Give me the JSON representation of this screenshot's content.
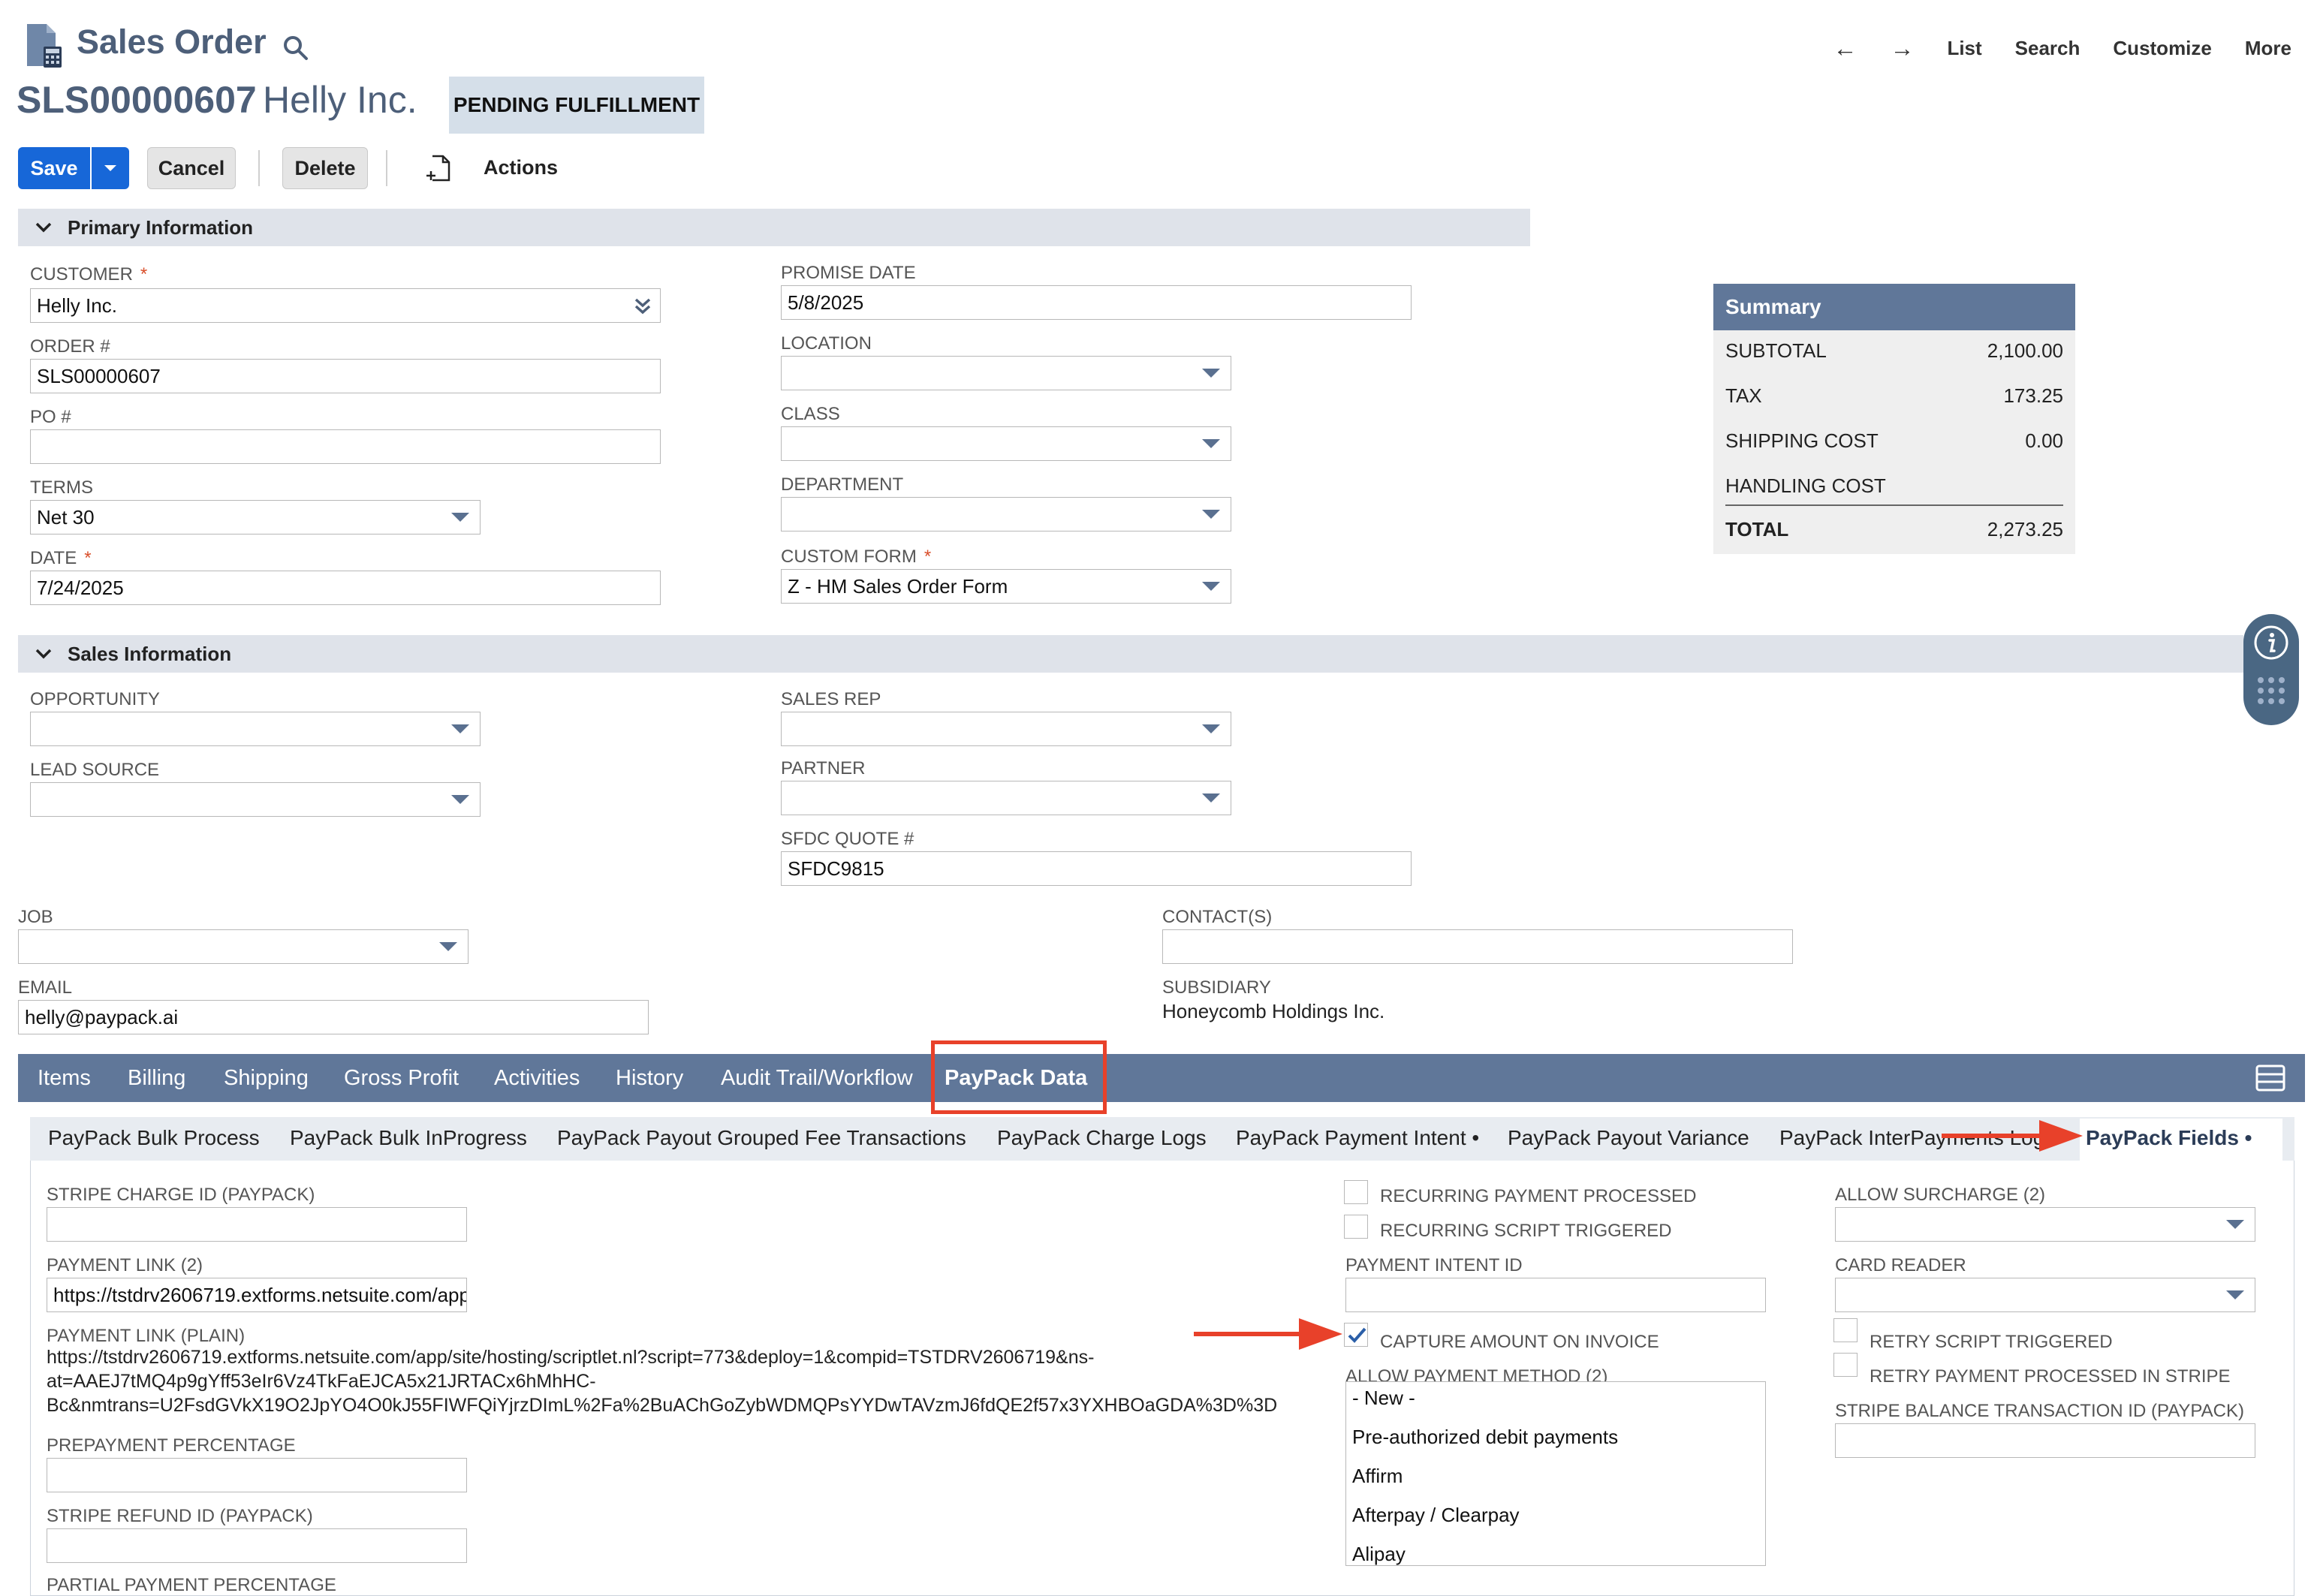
{
  "header": {
    "record_type": "Sales Order",
    "record_id": "SLS00000607",
    "record_name": "Helly Inc.",
    "status": "PENDING FULFILLMENT",
    "nav": {
      "back": "←",
      "forward": "→",
      "list": "List",
      "search": "Search",
      "customize": "Customize",
      "more": "More"
    }
  },
  "toolbar": {
    "save": "Save",
    "cancel": "Cancel",
    "delete": "Delete",
    "actions": "Actions"
  },
  "primary": {
    "title": "Primary Information",
    "customer": {
      "label": "CUSTOMER",
      "value": "Helly Inc."
    },
    "order_no": {
      "label": "ORDER #",
      "value": "SLS00000607"
    },
    "po_no": {
      "label": "PO #",
      "value": ""
    },
    "terms": {
      "label": "TERMS",
      "value": "Net 30"
    },
    "date": {
      "label": "DATE",
      "value": "7/24/2025"
    },
    "promise_date": {
      "label": "PROMISE DATE",
      "value": "5/8/2025"
    },
    "location": {
      "label": "LOCATION",
      "value": ""
    },
    "class": {
      "label": "CLASS",
      "value": ""
    },
    "department": {
      "label": "DEPARTMENT",
      "value": ""
    },
    "custom_form": {
      "label": "CUSTOM FORM",
      "value": "Z - HM Sales Order Form"
    },
    "required_mark": "*"
  },
  "summary": {
    "title": "Summary",
    "rows": [
      {
        "label": "SUBTOTAL",
        "value": "2,100.00"
      },
      {
        "label": "TAX",
        "value": "173.25"
      },
      {
        "label": "SHIPPING COST",
        "value": "0.00"
      },
      {
        "label": "HANDLING COST",
        "value": ""
      }
    ],
    "total": {
      "label": "TOTAL",
      "value": "2,273.25"
    }
  },
  "sales": {
    "title": "Sales Information",
    "opportunity": {
      "label": "OPPORTUNITY",
      "value": ""
    },
    "lead_source": {
      "label": "LEAD SOURCE",
      "value": ""
    },
    "sales_rep": {
      "label": "SALES REP",
      "value": ""
    },
    "partner": {
      "label": "PARTNER",
      "value": ""
    },
    "sfdc_quote": {
      "label": "SFDC QUOTE #",
      "value": "SFDC9815"
    }
  },
  "misc": {
    "job": {
      "label": "JOB",
      "value": ""
    },
    "email": {
      "label": "EMAIL",
      "value": "helly@paypack.ai"
    },
    "contacts": {
      "label": "CONTACT(S)",
      "value": ""
    },
    "subsidiary": {
      "label": "SUBSIDIARY",
      "value": "Honeycomb Holdings Inc."
    }
  },
  "tabs": {
    "items": [
      {
        "label": "Items"
      },
      {
        "label": "Billing"
      },
      {
        "label": "Shipping"
      },
      {
        "label": "Gross Profit"
      },
      {
        "label": "Activities"
      },
      {
        "label": "History"
      },
      {
        "label": "Audit Trail/Workflow"
      },
      {
        "label": "PayPack Data"
      }
    ],
    "active": "PayPack Data"
  },
  "subtabs": {
    "items": [
      {
        "label": "PayPack Bulk Process"
      },
      {
        "label": "PayPack Bulk InProgress"
      },
      {
        "label": "PayPack Payout Grouped Fee Transactions"
      },
      {
        "label": "PayPack Charge Logs"
      },
      {
        "label": "PayPack Payment Intent •"
      },
      {
        "label": "PayPack Payout Variance"
      },
      {
        "label": "PayPack InterPayments Log"
      },
      {
        "label": "PayPack Fields •"
      }
    ],
    "active": "PayPack Fields •"
  },
  "paypack": {
    "stripe_charge_id": {
      "label": "STRIPE CHARGE ID (PAYPACK)",
      "value": ""
    },
    "payment_link": {
      "label": "PAYMENT LINK (2)",
      "value": "https://tstdrv2606719.extforms.netsuite.com/app"
    },
    "payment_link_plain": {
      "label": "PAYMENT LINK (PLAIN)",
      "line1": "https://tstdrv2606719.extforms.netsuite.com/app/site/hosting/scriptlet.nl?script=773&deploy=1&compid=TSTDRV2606719&ns-",
      "line2": "at=AAEJ7tMQ4p9gYff53eIr6Vz4TkFaEJCA5x21JRTACx6hMhHC-",
      "line3": "Bc&nmtrans=U2FsdGVkX19O2JpYO4O0kJ55FIWFQiYjrzDImL%2Fa%2BuAChGoZybWDMQPsYYDwTAVzmJ6fdQE2f57x3YXHBOaGDA%3D%3D"
    },
    "prepayment_pct": {
      "label": "PREPAYMENT PERCENTAGE",
      "value": ""
    },
    "stripe_refund_id": {
      "label": "STRIPE REFUND ID (PAYPACK)",
      "value": ""
    },
    "partial_payment_pct": {
      "label": "PARTIAL PAYMENT PERCENTAGE",
      "value": ""
    },
    "recurring_processed": {
      "label": "RECURRING PAYMENT PROCESSED",
      "checked": false
    },
    "recurring_script": {
      "label": "RECURRING SCRIPT TRIGGERED",
      "checked": false
    },
    "payment_intent_id": {
      "label": "PAYMENT INTENT ID",
      "value": ""
    },
    "capture_on_invoice": {
      "label": "CAPTURE AMOUNT ON INVOICE",
      "checked": true
    },
    "allow_payment_method": {
      "label": "ALLOW PAYMENT METHOD (2)",
      "options": [
        "- New -",
        "Pre-authorized debit payments",
        "Affirm",
        "Afterpay / Clearpay",
        "Alipay"
      ]
    },
    "allow_surcharge": {
      "label": "ALLOW SURCHARGE (2)",
      "value": ""
    },
    "card_reader": {
      "label": "CARD READER",
      "value": ""
    },
    "retry_script": {
      "label": "RETRY SCRIPT TRIGGERED",
      "checked": false
    },
    "retry_payment": {
      "label": "RETRY PAYMENT PROCESSED IN STRIPE",
      "checked": false
    },
    "stripe_balance_txn": {
      "label": "STRIPE BALANCE TRANSACTION ID (PAYPACK)",
      "value": ""
    }
  },
  "colors": {
    "brand_blue": "#1767d8",
    "tab_bar": "#607799",
    "title_text": "#4d5f79",
    "highlight_red": "#e8412a",
    "section_bar": "#dfe3ea"
  }
}
